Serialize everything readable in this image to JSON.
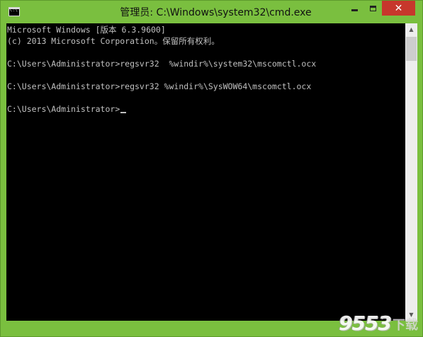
{
  "window": {
    "title": "管理员: C:\\Windows\\system32\\cmd.exe",
    "icon": "cmd-icon",
    "icon_text": "C:\\",
    "close_glyph": "✕"
  },
  "console": {
    "lines": [
      "Microsoft Windows [版本 6.3.9600]",
      "(c) 2013 Microsoft Corporation。保留所有权利。",
      "",
      "C:\\Users\\Administrator>regsvr32  %windir%\\system32\\mscomctl.ocx",
      "",
      "C:\\Users\\Administrator>regsvr32 %windir%\\SysWOW64\\mscomctl.ocx",
      "",
      "C:\\Users\\Administrator>"
    ]
  },
  "scrollbar": {
    "up_arrow": "▲",
    "down_arrow": "▼"
  },
  "watermark": {
    "number": "9553",
    "text": "下载"
  },
  "colors": {
    "frame": "#7abf3f",
    "console_bg": "#000000",
    "console_fg": "#c0c0c0",
    "close_button": "#c7372c"
  }
}
